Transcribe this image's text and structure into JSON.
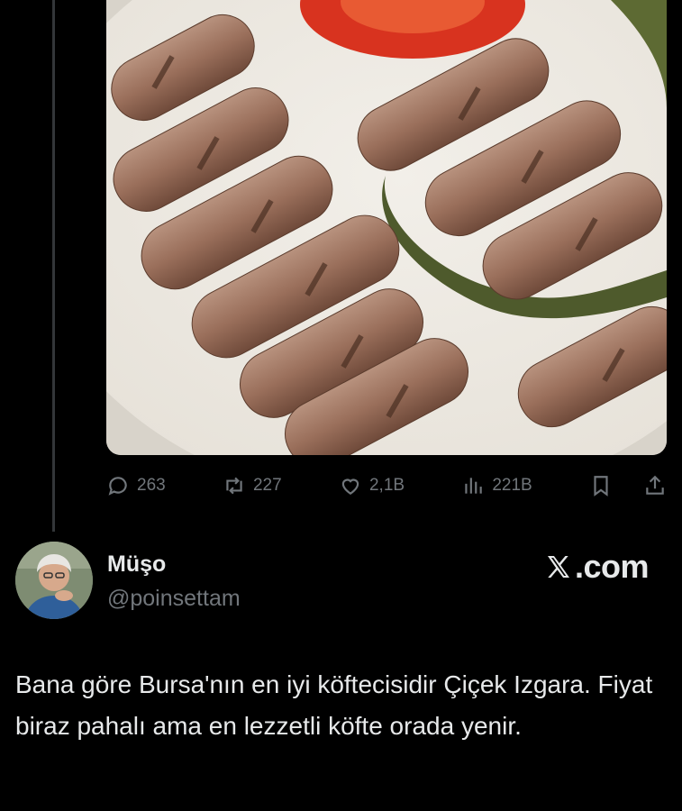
{
  "stats": {
    "replies": "263",
    "reposts": "227",
    "likes": "2,1B",
    "views": "221B"
  },
  "icons": {
    "reply": "speech-bubble-icon",
    "repost": "repost-arrows-icon",
    "like": "heart-icon",
    "views": "bar-chart-icon",
    "bookmark": "bookmark-icon",
    "share": "share-upload-icon"
  },
  "author": {
    "name": "Müşo",
    "handle": "@poinsettam"
  },
  "brand": {
    "text": ".com"
  },
  "tweet": {
    "text": "Bana göre Bursa'nın en iyi köftecisidir Çiçek Izgara. Fiyat biraz pahalı ama en lezzetli köfte orada yenir."
  },
  "colors": {
    "background": "#000000",
    "text": "#e7e9ea",
    "muted": "#71767b"
  }
}
